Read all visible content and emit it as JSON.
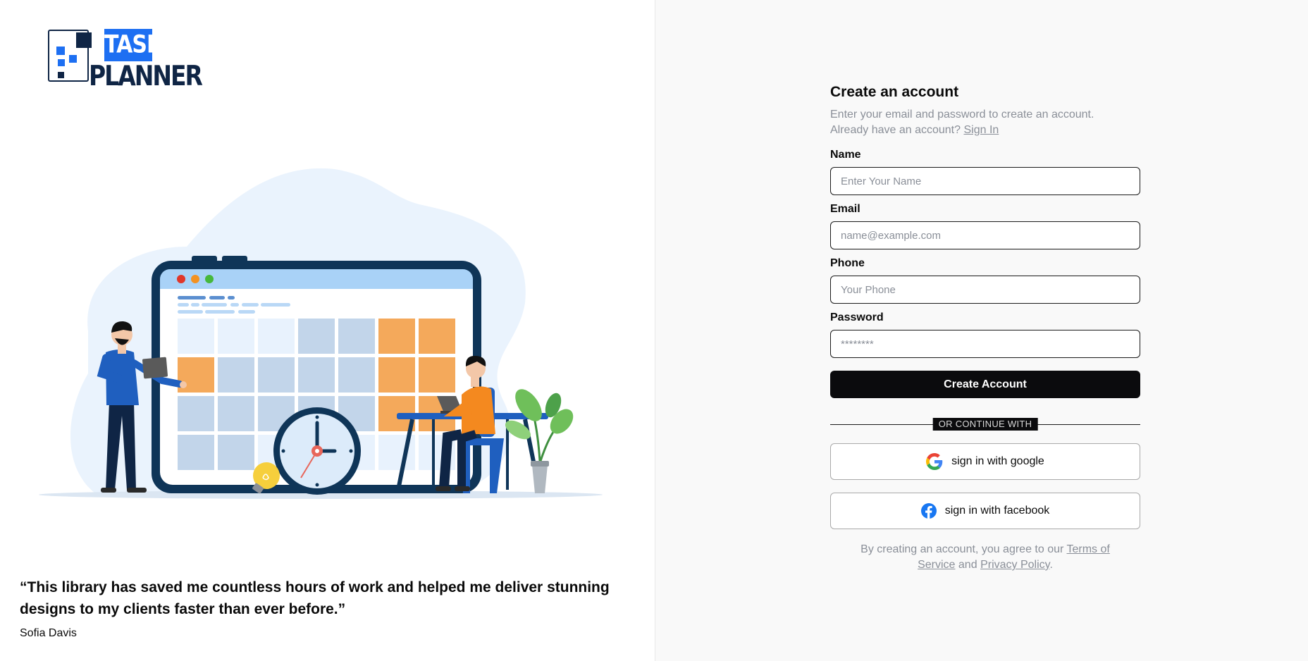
{
  "brand": {
    "logo_word_1": "TASK",
    "logo_word_2": "PLANNER"
  },
  "testimonial": {
    "quote": "“This library has saved me countless hours of work and helped me deliver stunning designs to my clients faster than ever before.”",
    "author": "Sofia Davis"
  },
  "form": {
    "title": "Create an account",
    "subtitle_line1": "Enter your email and password to create an account.",
    "subtitle_line2": "Already have an account?",
    "signin_link": "Sign In",
    "name_label": "Name",
    "name_placeholder": "Enter Your Name",
    "email_label": "Email",
    "email_placeholder": "name@example.com",
    "phone_label": "Phone",
    "phone_placeholder": "Your Phone",
    "password_label": "Password",
    "password_placeholder": "********",
    "submit_label": "Create Account",
    "divider_text": "OR CONTINUE WITH",
    "google_label": "sign in with google",
    "facebook_label": "sign in with facebook",
    "terms_prefix": "By creating an account, you agree to our",
    "terms_link": "Terms of Service",
    "terms_and": "and",
    "privacy_link": "Privacy Policy",
    "terms_suffix": "."
  },
  "colors": {
    "brand_blue": "#1d6ff2",
    "brand_navy": "#0f2545",
    "button_black": "#0b0b0d",
    "muted_text": "#8a8f98",
    "calendar_orange": "#f4a95b",
    "calendar_blue": "#c2d5ea"
  },
  "icons": [
    "google-icon",
    "facebook-icon",
    "clock-icon",
    "lightbulb-icon",
    "plant-icon",
    "laptop-icon"
  ]
}
